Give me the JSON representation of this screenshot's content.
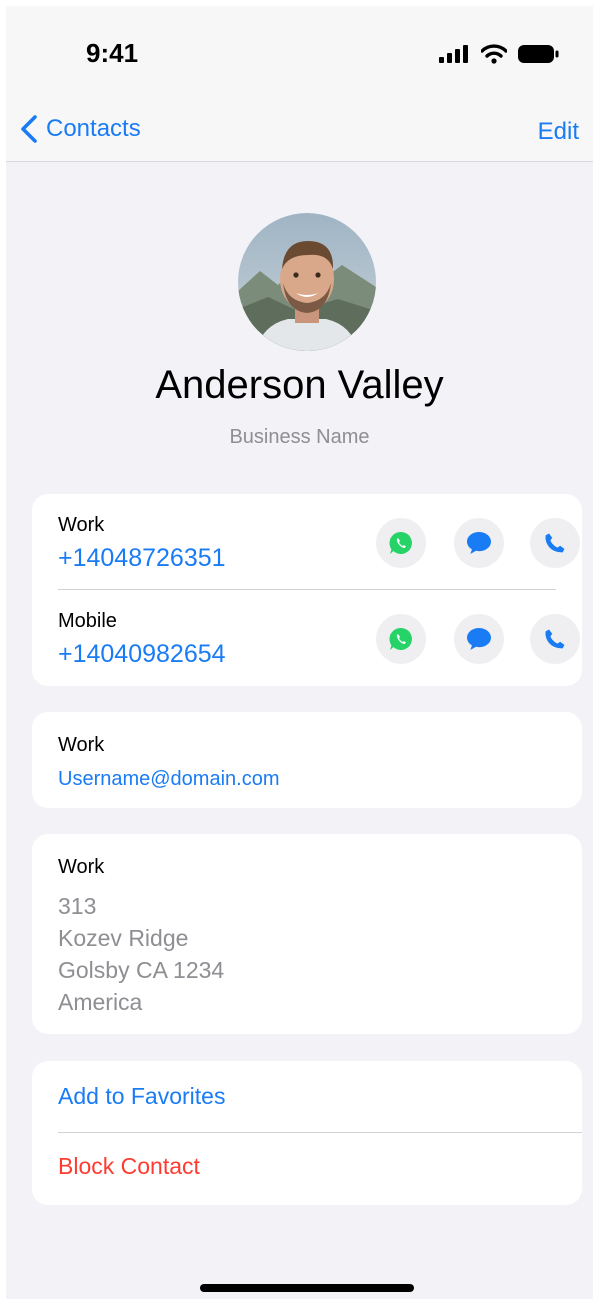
{
  "status_bar": {
    "time": "9:41"
  },
  "nav": {
    "back_label": "Contacts",
    "edit_label": "Edit"
  },
  "contact": {
    "name": "Anderson Valley",
    "business": "Business Name"
  },
  "phones": [
    {
      "label": "Work",
      "number": "+14048726351"
    },
    {
      "label": "Mobile",
      "number": "+14040982654"
    }
  ],
  "email": {
    "label": "Work",
    "value": "Username@domain.com"
  },
  "address": {
    "label": "Work",
    "lines": [
      "313",
      "Kozev Ridge",
      "Golsby CA 1234",
      "America"
    ]
  },
  "actions": {
    "favorites_label": "Add to Favorites",
    "block_label": "Block Contact"
  },
  "colors": {
    "accent": "#1a7cf5",
    "destructive": "#ff3b30",
    "whatsapp": "#25d366",
    "secondary_text": "#8e8e93",
    "background": "#f2f2f7"
  },
  "icons": [
    "chevron-left-icon",
    "whatsapp-icon",
    "message-icon",
    "phone-icon",
    "signal-icon",
    "wifi-icon",
    "battery-icon"
  ]
}
